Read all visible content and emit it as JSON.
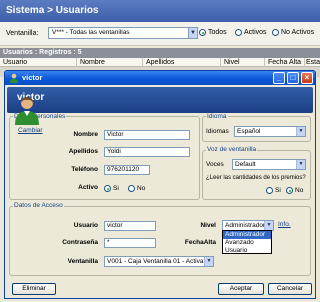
{
  "app": {
    "title": "Sistema > Usuarios",
    "ventanilla_label": "Ventanilla:",
    "ventanilla_value": "V*** - Todas las ventanillas",
    "filter_options": [
      {
        "label": "Todos",
        "selected": true
      },
      {
        "label": "Activos",
        "selected": false
      },
      {
        "label": "No Activos",
        "selected": false
      }
    ],
    "count_text": "Usuarios : Registros : 5",
    "columns": [
      "Usuario",
      "Nombre",
      "Apellidos",
      "Nivel",
      "Fecha Alta",
      "Estado"
    ]
  },
  "dialog": {
    "title": "victor",
    "header_name": "victor",
    "datos_personales": {
      "title": "Datos Personales",
      "cambiar_label": "Cambiar",
      "nombre_label": "Nombre",
      "nombre_value": "Victor",
      "apellidos_label": "Apellidos",
      "apellidos_value": "Yoldi",
      "telefono_label": "Teléfono",
      "telefono_value": "976201120",
      "activo_label": "Activo",
      "activo_si": "Si",
      "activo_no": "No"
    },
    "idioma": {
      "title": "Idioma",
      "label": "Idiomas",
      "value": "Español"
    },
    "voz": {
      "title": "Voz de ventanilla",
      "voces_label": "Voces",
      "voces_value": "Default",
      "question": "¿Leer las cantidades de los premios?",
      "si": "Si",
      "no": "No"
    },
    "datos_acceso": {
      "title": "Datos de Acceso",
      "usuario_label": "Usuario",
      "usuario_value": "victor",
      "contrasena_label": "Contraseña",
      "contrasena_value": "*",
      "ventanilla_label": "Ventanilla",
      "ventanilla_value": "V001 - Caja Ventanilla 01 - Activa",
      "nivel_label": "Nivel",
      "nivel_value": "Administrador",
      "nivel_options": [
        "Administrador",
        "Avanzado",
        "Usuario"
      ],
      "fechaalta_label": "FechaAlta",
      "info_label": "Info."
    },
    "buttons": {
      "eliminar": "Eliminar",
      "aceptar": "Aceptar",
      "cancelar": "Cancelar"
    }
  },
  "colors": {
    "titlebar": "#0a57d8",
    "header_band": "#1b3f84",
    "group_title": "#15428b",
    "selection": "#316ac5",
    "close_button": "#c53b15"
  }
}
